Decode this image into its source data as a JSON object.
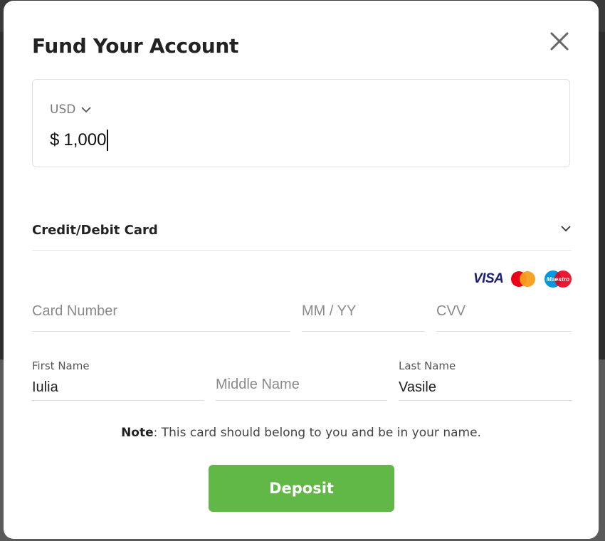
{
  "modal": {
    "title": "Fund Your Account",
    "close_icon": "close-icon"
  },
  "amount": {
    "currency": "USD",
    "symbol": "$",
    "value": "1,000"
  },
  "payment_method": {
    "label": "Credit/Debit Card",
    "icon": "chevron-down-icon"
  },
  "card_logos": {
    "visa": "VISA",
    "mastercard": "mastercard-logo",
    "maestro": "Maestro"
  },
  "fields": {
    "card_number": {
      "placeholder": "Card Number",
      "value": ""
    },
    "expiry": {
      "placeholder": "MM / YY",
      "value": ""
    },
    "cvv": {
      "placeholder": "CVV",
      "value": ""
    },
    "first_name": {
      "label": "First Name",
      "value": "Iulia"
    },
    "middle_name": {
      "placeholder": "Middle Name",
      "value": ""
    },
    "last_name": {
      "label": "Last Name",
      "value": "Vasile"
    }
  },
  "note": {
    "bold": "Note",
    "text": ": This card should belong to you and be in your name."
  },
  "deposit_button": "Deposit",
  "colors": {
    "accent": "#62b847",
    "visa": "#1a1f71",
    "mastercard_red": "#eb001b",
    "mastercard_orange": "#f79e1b",
    "maestro_blue": "#0099df"
  }
}
